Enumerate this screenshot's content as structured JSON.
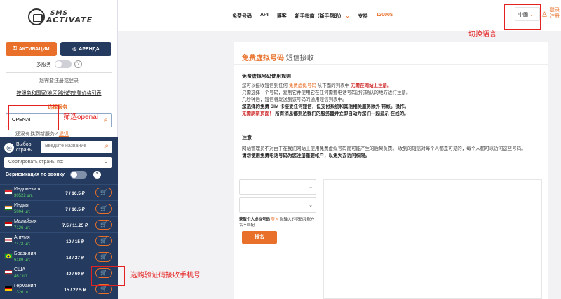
{
  "logo": {
    "line1": "SMS",
    "line2": "ACTIVATE"
  },
  "modes": {
    "activation": "АКТИВАЦИИ",
    "rent": "АРЕНДА"
  },
  "multi_service": {
    "label": "多服务"
  },
  "register_note": "您需要注册或登录",
  "price_link": "按服务和国家/地区列出的完整价格列表",
  "choose_service_label": "选择服务",
  "search": {
    "value": "OPENAI"
  },
  "not_found": {
    "text": "还没有找到新服务?",
    "link": "提供"
  },
  "country_panel": {
    "button": "Выбор страны",
    "search_placeholder": "Введите название",
    "sort_label": "Сортировать страны по:",
    "verify_label": "Верификация по звонку"
  },
  "countries": [
    {
      "name": "Индонези я",
      "count": "30522 шт.",
      "price": "7 / 10.5 ₽"
    },
    {
      "name": "Индия",
      "count": "5004 шт.",
      "price": "7 / 10.5 ₽"
    },
    {
      "name": "Малайзия",
      "count": "7126 шт.",
      "price": "7.5 / 11.25 ₽"
    },
    {
      "name": "Англия",
      "count": "7472 шт.",
      "price": "10 / 15 ₽"
    },
    {
      "name": "Бразилия",
      "count": "6189 шт.",
      "price": "18 / 27 ₽"
    },
    {
      "name": "США",
      "count": "467 шт.",
      "price": "40 / 60 ₽"
    },
    {
      "name": "Германия",
      "count": "1326 шт.",
      "price": "15 / 22.5 ₽"
    }
  ],
  "header": {
    "nav": [
      "免费号码",
      "API",
      "博客",
      "新手指南（新手帮助）",
      "支持"
    ],
    "balance": "12000$",
    "language": "中國",
    "login": "登录",
    "register": "注册"
  },
  "card": {
    "title": "免费虚拟号码",
    "subtitle": "短信接收",
    "rules_title": "免费虚拟号码使用规则",
    "rules_1a": "您可以接收短信到任何",
    "rules_1b": "免费虚拟号码",
    "rules_1c": "从下面的列表中",
    "rules_1d": "无需在网站上注册。",
    "rules_2": "只需选择一个号码，复制它并使用它在任何需要电话号码进行确认的地方进行注册。",
    "rules_3": "几秒钟后，短信将发送到该号码的通用短信列表中。",
    "rules_4": "您选择的免费 SIM 卡接受任何短信，但支付系统和其他相关服务除外 带帐。操作。",
    "rules_5a": "无需刷新页面！",
    "rules_5b": "所有消息都到达我们的服务器并立即自动为您们一起显示 在线的。",
    "note_title": "注意",
    "note_1": "网站管理员不对由于在我们网站上使用免费虚拟号码而可能产生的后果负责。 收到的短信对每个人都是可见的，每个人都可以访问这些号码。",
    "note_2": "请勿使用免费电话号码为您注册重要帐户，以免失去访问权限。",
    "get_text_a": "获取个人虚拟号码",
    "get_text_b": "登入",
    "get_text_c": "你输入的密码和账户名不匹配",
    "signup": "报名"
  },
  "annotations": {
    "lang": "切换语言",
    "filter": "筛选openai",
    "buy": "选购验证码接收手机号"
  },
  "colors": {
    "accent": "#e8702a",
    "navy": "#243a5e",
    "annotation": "#e52020"
  }
}
